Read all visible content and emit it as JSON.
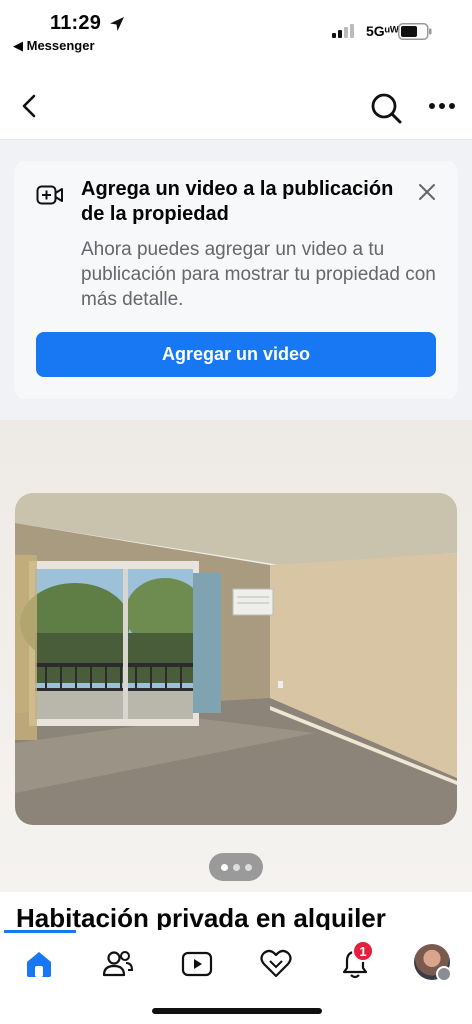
{
  "status_bar": {
    "time": "11:29",
    "back_app": "◀ Messenger",
    "network": "5Gᵘᵂ"
  },
  "navbar": {
    "back_icon": "chevron-left-icon",
    "search_icon": "search-icon",
    "more_icon": "more-horizontal-icon"
  },
  "banner": {
    "icon": "video-add-icon",
    "title": "Agrega un video a la publicación de la propiedad",
    "body": "Ahora puedes agregar un video a tu publicación para mostrar tu propiedad con más detalle.",
    "button_label": "Agregar un video",
    "button_color": "#1877f2"
  },
  "photo": {
    "pager_count": 3,
    "pager_active": 1
  },
  "listing": {
    "title": "Habitación privada en alquiler"
  },
  "tabbar": {
    "tabs": [
      {
        "name": "home",
        "icon": "home-icon",
        "active": true
      },
      {
        "name": "friends",
        "icon": "friends-icon",
        "active": false
      },
      {
        "name": "video",
        "icon": "video-icon",
        "active": false
      },
      {
        "name": "dating",
        "icon": "dating-heart-icon",
        "active": false
      },
      {
        "name": "notifications",
        "icon": "bell-icon",
        "active": false
      },
      {
        "name": "profile",
        "icon": "avatar",
        "active": false
      }
    ],
    "notification_badge": "1",
    "accent_color": "#1877f2"
  }
}
